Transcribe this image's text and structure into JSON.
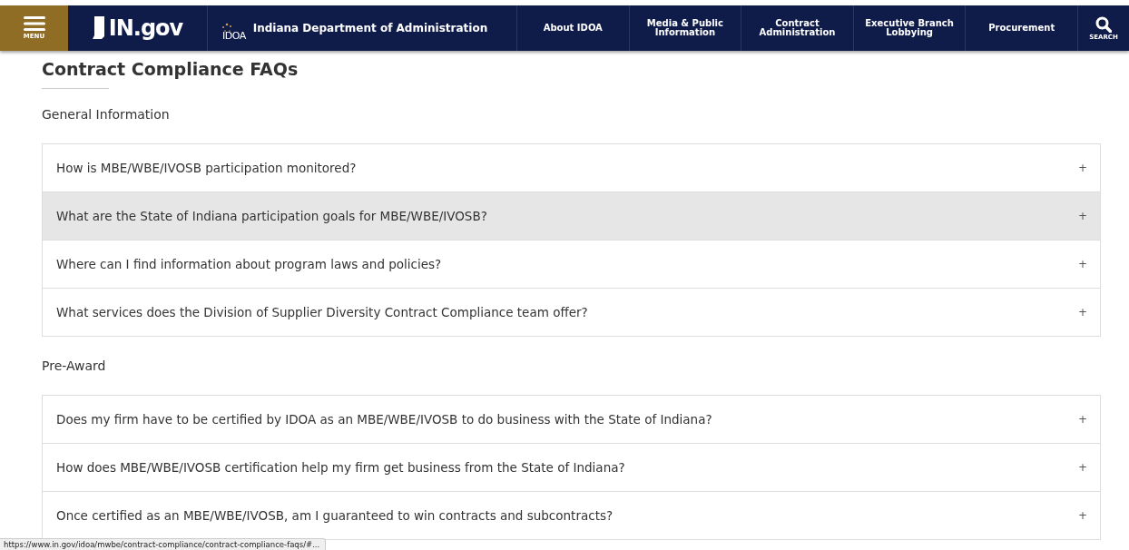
{
  "header": {
    "menu_label": "MENU",
    "logo_text": "IN.gov",
    "agency_mark": "IDOA",
    "agency_name": "Indiana Department of Administration",
    "nav": [
      {
        "label": "About IDOA"
      },
      {
        "label": "Media & Public Information"
      },
      {
        "label": "Contract Administration"
      },
      {
        "label": "Executive Branch Lobbying"
      },
      {
        "label": "Procurement"
      }
    ],
    "search_label": "SEARCH"
  },
  "page_title": "Contract Compliance FAQs",
  "sections": [
    {
      "heading": "General Information",
      "questions": [
        {
          "text": "How is MBE/WBE/IVOSB participation monitored?",
          "toggle": "+",
          "highlighted": false
        },
        {
          "text": "What are the State of Indiana participation goals for MBE/WBE/IVOSB?",
          "toggle": "+",
          "highlighted": true
        },
        {
          "text": "Where can I find information about program laws and policies?",
          "toggle": "+",
          "highlighted": false
        },
        {
          "text": "What services does the Division of Supplier Diversity Contract Compliance team offer?",
          "toggle": "+",
          "highlighted": false
        }
      ]
    },
    {
      "heading": "Pre-Award",
      "questions": [
        {
          "text": "Does my firm have to be certified by IDOA as an MBE/WBE/IVOSB to do business with the State of Indiana?",
          "toggle": "+",
          "highlighted": false
        },
        {
          "text": "How does MBE/WBE/IVOSB certification help my firm get business from the State of Indiana?",
          "toggle": "+",
          "highlighted": false
        },
        {
          "text": "Once certified as an MBE/WBE/IVOSB, am I guaranteed to win contracts and subcontracts?",
          "toggle": "+",
          "highlighted": false
        }
      ]
    }
  ],
  "status_url": "https://www.in.gov/idoa/mwbe/contract-compliance/contract-compliance-faqs/#..."
}
